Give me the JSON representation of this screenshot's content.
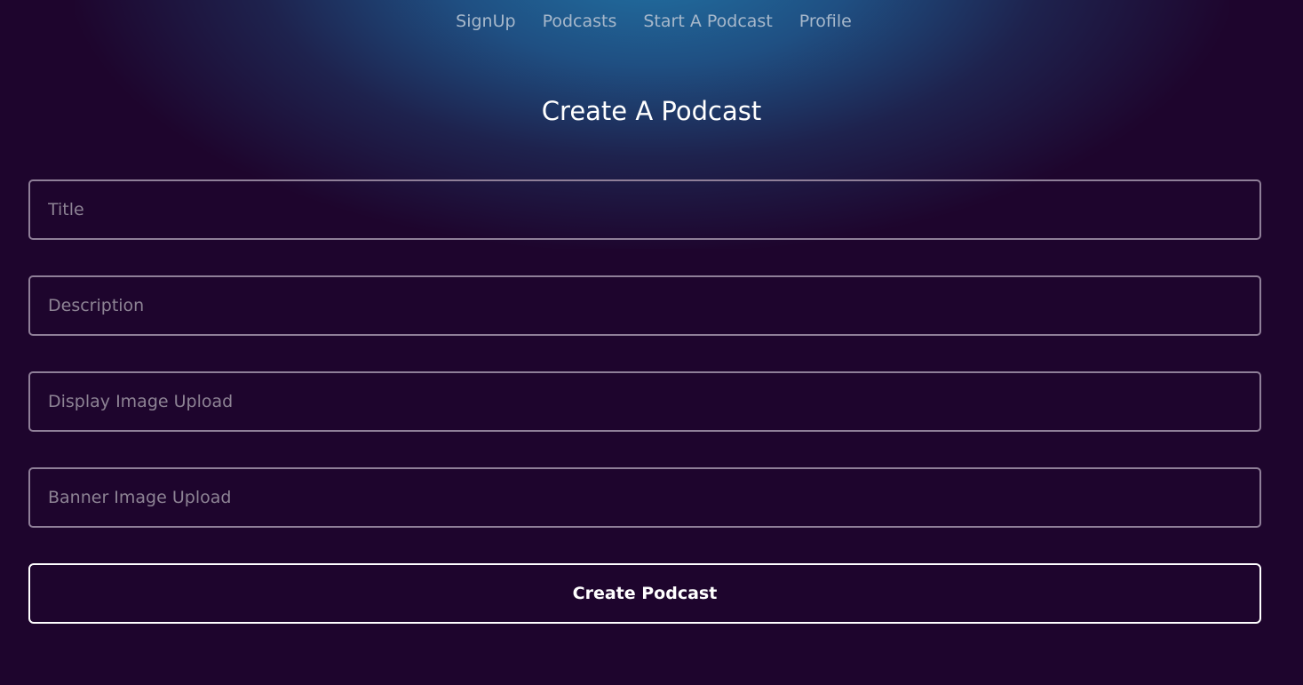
{
  "nav": {
    "items": [
      {
        "label": "SignUp"
      },
      {
        "label": "Podcasts"
      },
      {
        "label": "Start A Podcast"
      },
      {
        "label": "Profile"
      }
    ]
  },
  "page": {
    "title": "Create A Podcast"
  },
  "form": {
    "title": {
      "placeholder": "Title",
      "value": ""
    },
    "description": {
      "placeholder": "Description",
      "value": ""
    },
    "display_image": {
      "label": "Display Image Upload"
    },
    "banner_image": {
      "label": "Banner Image Upload"
    },
    "submit_label": "Create Podcast"
  },
  "colors": {
    "background": "#1e052d",
    "glow": "#2178aa",
    "nav_text": "#a7b8cb",
    "field_border": "#8f7f98",
    "button_border": "#ffffff"
  }
}
